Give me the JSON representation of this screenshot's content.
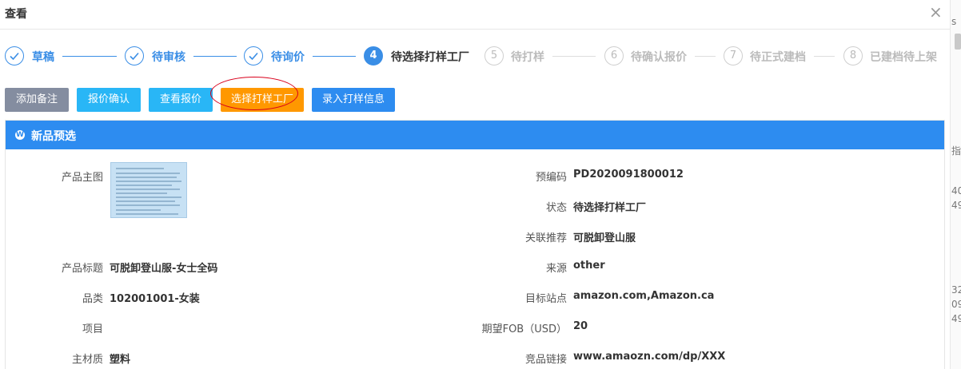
{
  "dialog": {
    "title": "查看",
    "close_label": "×"
  },
  "steps": [
    {
      "index": "1",
      "label": "草稿",
      "status": "done"
    },
    {
      "index": "2",
      "label": "待审核",
      "status": "done"
    },
    {
      "index": "3",
      "label": "待询价",
      "status": "done"
    },
    {
      "index": "4",
      "label": "待选择打样工厂",
      "status": "active"
    },
    {
      "index": "5",
      "label": "待打样",
      "status": "wait"
    },
    {
      "index": "6",
      "label": "待确认报价",
      "status": "wait"
    },
    {
      "index": "7",
      "label": "待正式建档",
      "status": "wait"
    },
    {
      "index": "8",
      "label": "已建档待上架",
      "status": "wait"
    }
  ],
  "toolbar": {
    "add_note": "添加备注",
    "confirm_quote": "报价确认",
    "view_quote": "查看报价",
    "select_factory": "选择打样工厂",
    "enter_sample_info": "录入打样信息"
  },
  "panel": {
    "title": "新品预选",
    "icon": "wordpress-icon",
    "icon_glyph": "W"
  },
  "fields": {
    "main_image_label": "产品主图",
    "product_title_label": "产品标题",
    "product_title": "可脱卸登山服-女士全码",
    "category_label": "品类",
    "category": "102001001-女装",
    "project_label": "项目",
    "project": "",
    "material_label": "主材质",
    "material": "塑料",
    "precode_label": "预编码",
    "precode": "PD2020091800012",
    "status_label": "状态",
    "status": "待选择打样工厂",
    "related_label": "关联推荐",
    "related": "可脱卸登山服",
    "source_label": "来源",
    "source": "other",
    "target_site_label": "目标站点",
    "target_site": "amazon.com,Amazon.ca",
    "fob_label": "期望FOB（USD）",
    "fob": "20",
    "competitor_label": "竞品链接",
    "competitor": "www.amaozn.com/dp/XXX"
  },
  "background_page": {
    "chars": [
      "s",
      "指",
      "40",
      "49",
      "32",
      "09",
      "49"
    ]
  },
  "colors": {
    "primary": "#2d8cf0",
    "step_done": "#3a8ee6",
    "btn_gray": "#848da0",
    "btn_cyan": "#29b6f6",
    "btn_orange": "#ff9800",
    "annotation_red": "#d9001b"
  }
}
